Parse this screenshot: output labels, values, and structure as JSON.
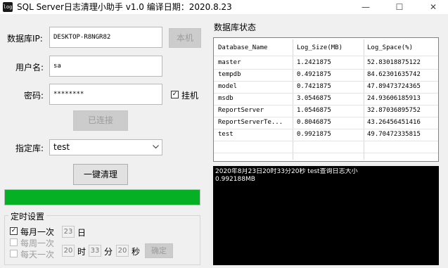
{
  "window": {
    "icon_text": "log",
    "title": "SQL Server日志清理小助手 v1.0    编译日期：2020.8.23",
    "minimize_glyph": "—",
    "maximize_glyph": "☐",
    "close_glyph": "✕"
  },
  "form": {
    "ip_label": "数据库IP:",
    "ip_value": "DESKTOP-R8NGR82",
    "local_button": "本机",
    "user_label": "用户名:",
    "user_value": "sa",
    "password_label": "密码:",
    "password_value": "********",
    "hang_label": "挂机",
    "hang_checked": true,
    "connected_button": "已连接",
    "db_label": "指定库:",
    "db_value": "test",
    "clean_button": "一键清理",
    "progress": 1.0,
    "progress_color": "#06b025"
  },
  "schedule": {
    "title": "定时设置",
    "monthly_label": "每月一次",
    "monthly_checked": true,
    "monthly_day": "23",
    "day_unit": "日",
    "weekly_label": "每周一次",
    "daily_label": "每天一次",
    "hour": "20",
    "hour_unit": "时",
    "minute": "33",
    "minute_unit": "分",
    "second": "20",
    "second_unit": "秒",
    "confirm_button": "确定"
  },
  "status": {
    "title": "数据库状态",
    "columns": [
      "Database_Name",
      "Log_Size(MB)",
      "Log_Space(%)"
    ],
    "rows": [
      [
        "master",
        "1.2421875",
        "52.83018875122"
      ],
      [
        "tempdb",
        "0.4921875",
        "84.62301635742"
      ],
      [
        "model",
        "0.7421875",
        "47.89473724365"
      ],
      [
        "msdb",
        "3.0546875",
        "24.93606185913"
      ],
      [
        "ReportServer",
        "1.0546875",
        "32.87036895752"
      ],
      [
        "ReportServerTe...",
        "0.8046875",
        "43.26456451416"
      ],
      [
        "test",
        "0.9921875",
        "49.70472335815"
      ]
    ]
  },
  "log": {
    "lines": [
      "2020年8月23日20时33分20秒  test查询日志大小",
      "0.992188MB"
    ]
  }
}
